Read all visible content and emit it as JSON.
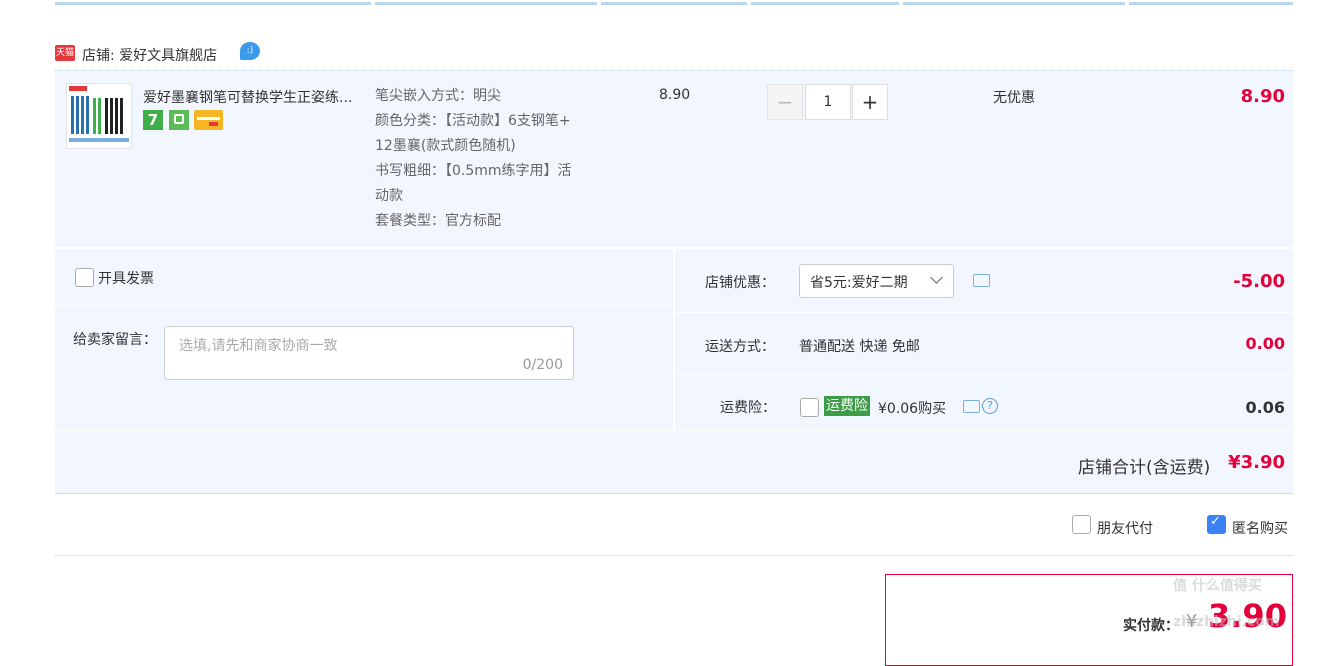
{
  "shop": {
    "tag": "天猫",
    "label": "店铺: 爱好文具旗舰店"
  },
  "item": {
    "title": "爱好墨襄钢笔可替换学生正姿练...",
    "sku": {
      "line1": "笔尖嵌入方式：明尖",
      "line2": "颜色分类：【活动款】6支钢笔+",
      "line3": "12墨襄(款式颜色随机)",
      "line4": "书写粗细：【0.5mm练字用】活",
      "line5": "动款",
      "line6": "套餐类型：官方标配"
    },
    "price": "8.90",
    "quantity": "1",
    "minus": "−",
    "plus": "+",
    "discount": "无优惠",
    "subtotal": "8.90",
    "badge7": "7"
  },
  "invoice": {
    "label": "开具发票"
  },
  "message": {
    "label": "给卖家留言：",
    "placeholder": "选填,请先和商家协商一致",
    "counter": "0/200"
  },
  "shop_discount": {
    "label": "店铺优惠：",
    "selected": "省5元:爱好二期",
    "amount": "-5.00"
  },
  "shipping": {
    "label": "运送方式：",
    "value": "普通配送 快递 免邮",
    "amount": "0.00"
  },
  "freight_insurance": {
    "label": "运费险：",
    "tag": "运费险",
    "price": "¥0.06购买",
    "amount": "0.06"
  },
  "shop_total": {
    "label": "店铺合计(含运费)",
    "amount": "¥3.90"
  },
  "options": {
    "friend_pay": "朋友代付",
    "anonymous": "匿名购买"
  },
  "payment": {
    "label": "实付款：",
    "currency": "¥",
    "amount": "3.90"
  },
  "colors": {
    "price_red": "#e4003a",
    "panel_bg": "#f2f7ff",
    "tmall_red": "#e4393c",
    "insurance_green": "#3c9d46"
  },
  "watermark": "值 什么值得买 zhizhizhi.com"
}
